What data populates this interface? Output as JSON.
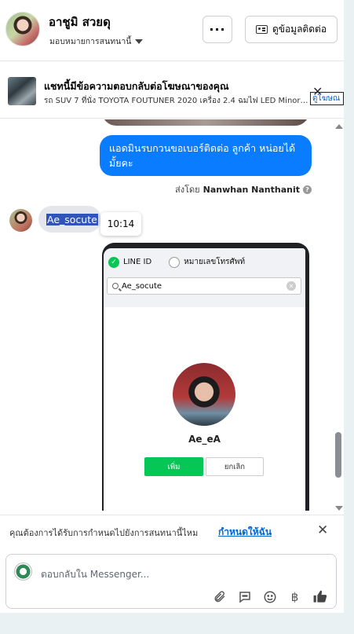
{
  "header": {
    "contact_name": "อาชูมิ สวยดุ",
    "assign_label": "มอบหมายการสนทนานี้",
    "more_label": "···",
    "view_contact_label": "ดูข้อมูลติดต่อ"
  },
  "ad": {
    "title": "แชทนี้มีข้อความตอบกลับต่อโฆษณาของคุณ",
    "subtitle": "รถ SUV 7 ที่นั่ง TOYOTA FOUTUNER 2020 เครื่อง 2.4 ฉมไฟ LED Minor C...",
    "close": "✕",
    "link": "ดูโฆษณ"
  },
  "messages": {
    "outgoing_text": "แอดมินรบกวนขอเบอร์ติดต่อ ลูกค้า หน่อยได้มั้ยคะ",
    "sent_by_label": "ส่งโดย",
    "sent_by_name": "Nanwhan Nanthanit",
    "incoming_text": "Ae_socute",
    "time_tooltip": "10:14"
  },
  "shared_screenshot": {
    "radio_line_id": "LINE ID",
    "radio_phone": "หมายเลขโทรศัพท์",
    "search_value": "Ae_socute",
    "profile_name": "Ae_eA",
    "add_label": "เพิ่ม",
    "cancel_label": "ยกเลิก"
  },
  "reminder": {
    "text": "คุณต้องการได้รับการกำหนดไปยังการสนทนานี้ไหม",
    "link": "กำหนดให้ฉัน",
    "close": "✕"
  },
  "composer": {
    "placeholder": "ตอบกลับใน Messenger..."
  },
  "icons": {
    "attach": "paperclip-icon",
    "saved_reply": "chat-bubble-icon",
    "emoji": "smiley-icon",
    "currency": "baht-icon",
    "like": "thumbs-up-icon"
  },
  "colors": {
    "accent": "#0a7cff",
    "link": "#0064d1",
    "line_green": "#06c755"
  }
}
